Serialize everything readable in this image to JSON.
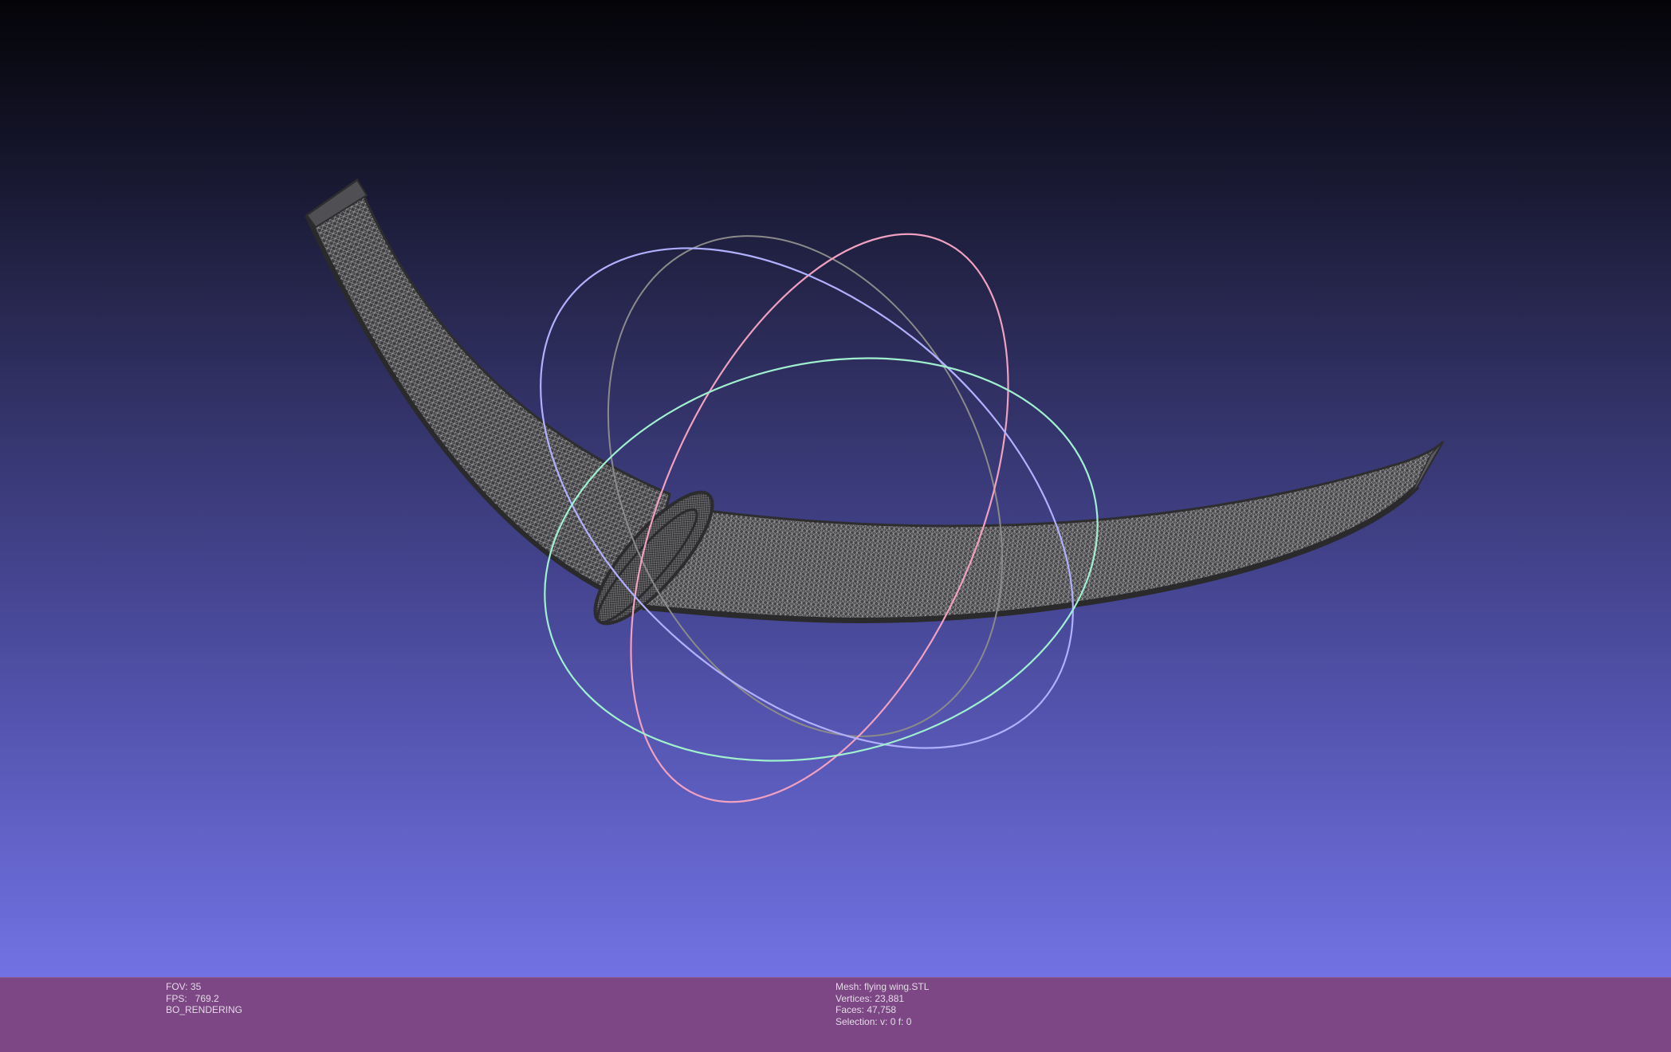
{
  "viewer": {
    "background_top": "#040408",
    "background_bottom": "#7272e4",
    "mesh_color": "#4a4a4a",
    "wireframe_color": "#9a9a9a"
  },
  "trackball": {
    "x_axis_color": "#f0a0c0",
    "y_axis_color": "#a0f0d0",
    "z_axis_color": "#b0b0ff",
    "inactive_color": "#8a8a8a"
  },
  "info_left": {
    "fov": "FOV: 35",
    "fps": "FPS:   769.2",
    "render_mode": "BO_RENDERING"
  },
  "info_right": {
    "mesh": "Mesh: flying wing.STL",
    "vertices": "Vertices: 23,881",
    "faces": "Faces: 47,758",
    "selection": "Selection: v: 0 f: 0"
  },
  "info_bar_color": "#7d4684"
}
